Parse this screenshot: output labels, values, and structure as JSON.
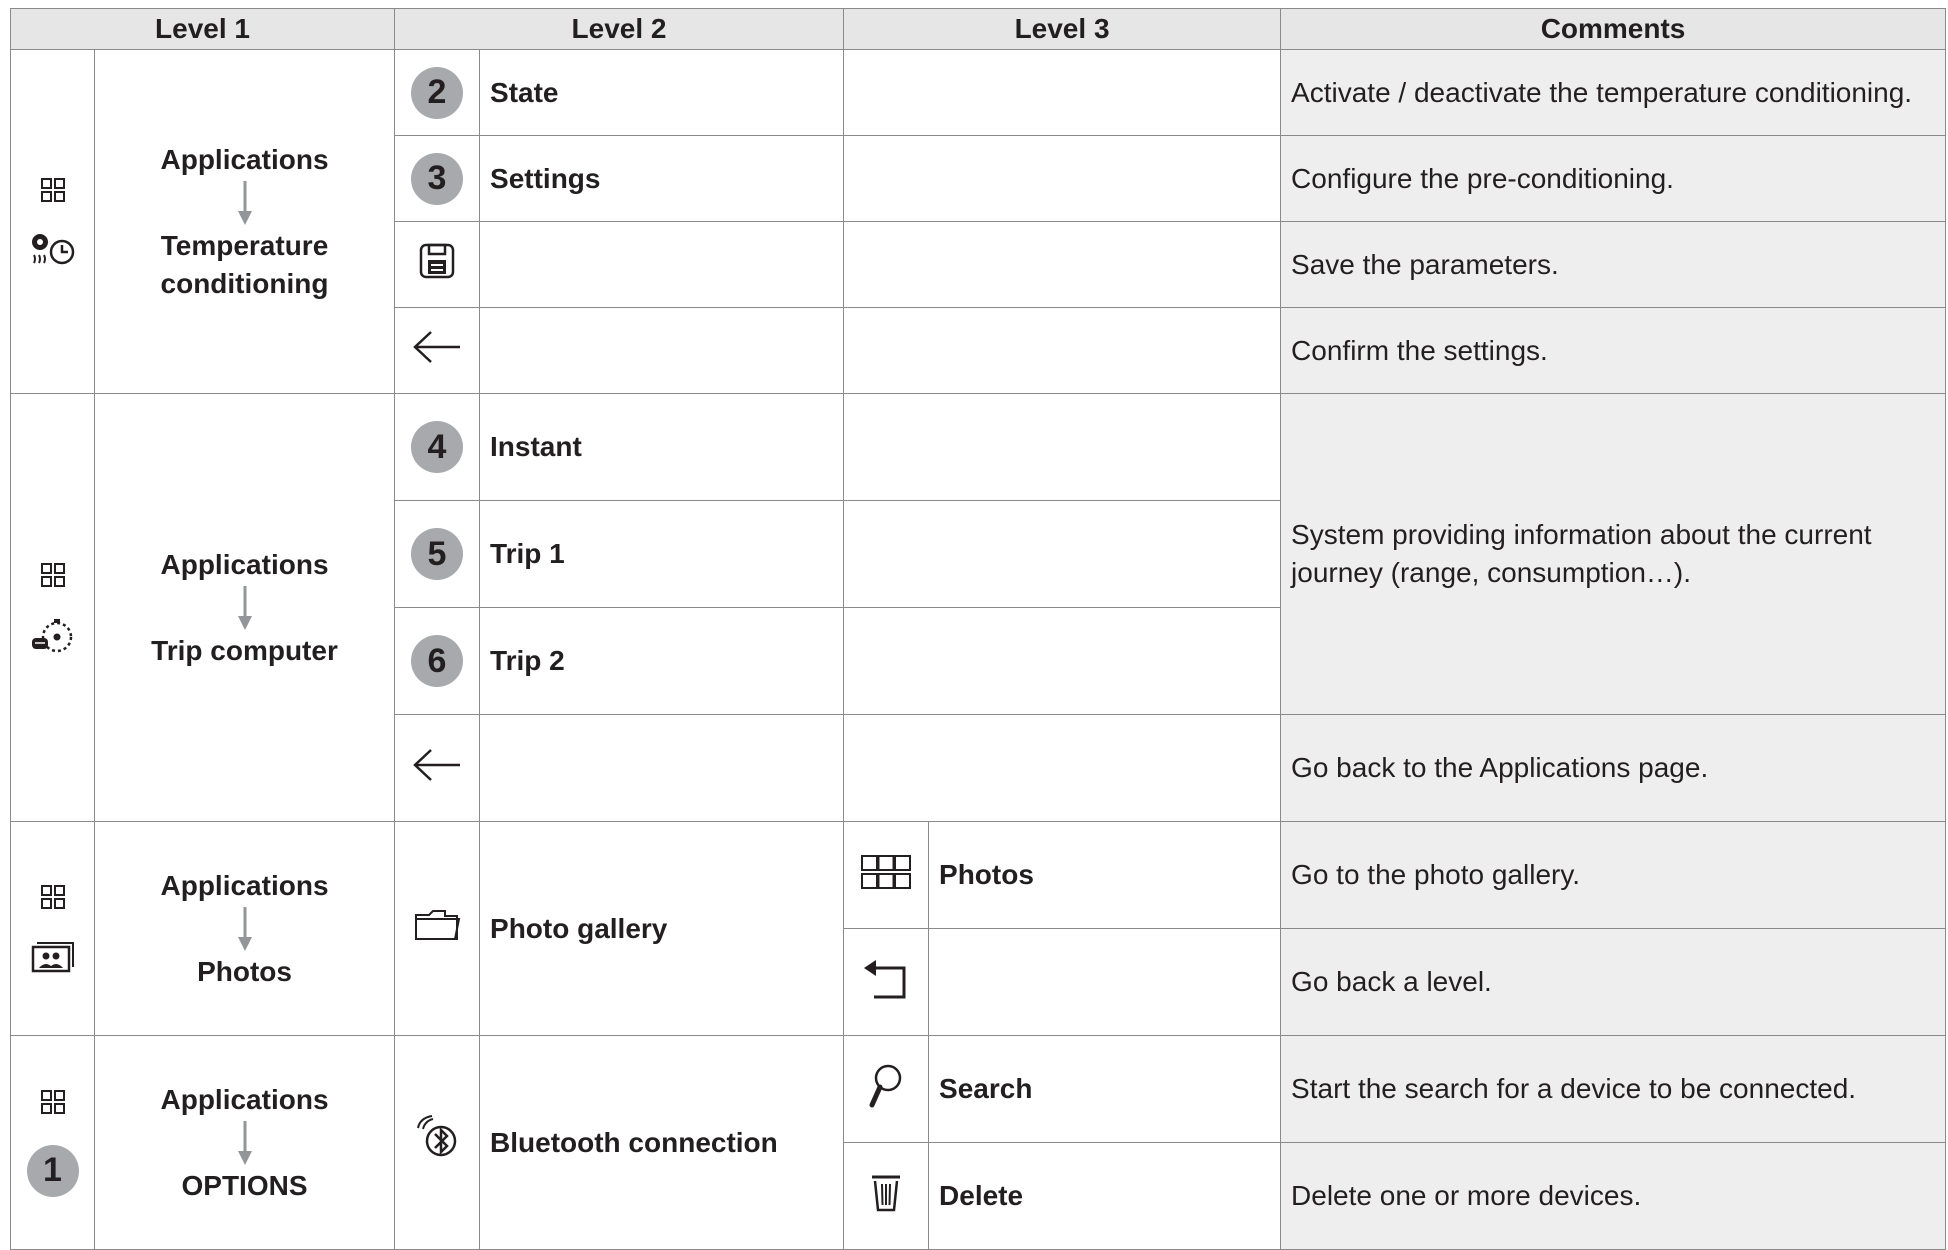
{
  "headers": [
    "Level 1",
    "Level 2",
    "Level 3",
    "Comments"
  ],
  "sections": [
    {
      "l1_top": "Applications",
      "l1_bottom": "Temperature conditioning",
      "section_icon": "fan-clock-icon",
      "rows": [
        {
          "badge": "2",
          "label": "State",
          "comment": "Activate / deactivate the temperature conditioning."
        },
        {
          "badge": "3",
          "label": "Settings",
          "comment": "Configure the pre-conditioning."
        },
        {
          "icon": "save-icon",
          "comment": "Save the parameters."
        },
        {
          "icon": "back-arrow-icon",
          "comment": "Confirm the settings."
        }
      ]
    },
    {
      "l1_top": "Applications",
      "l1_bottom": "Trip computer",
      "section_icon": "trip-computer-icon",
      "rows": [
        {
          "badge": "4",
          "label": "Instant"
        },
        {
          "badge": "5",
          "label": "Trip 1"
        },
        {
          "badge": "6",
          "label": "Trip 2"
        },
        {
          "icon": "back-arrow-icon",
          "comment": "Go back to the Applications page."
        }
      ],
      "merged_comment": "System providing information about the current journey (range, consumption…)."
    },
    {
      "l1_top": "Applications",
      "l1_bottom": "Photos",
      "section_icon": "photos-icon",
      "l2_icon": "folder-icon",
      "l2_label": "Photo gallery",
      "rows": [
        {
          "icon": "grid-icon",
          "label": "Photos",
          "comment": "Go to the photo gallery."
        },
        {
          "icon": "return-icon",
          "comment": "Go back a level."
        }
      ]
    },
    {
      "l1_top": "Applications",
      "l1_bottom": "OPTIONS",
      "section_badge": "1",
      "l2_icon": "bluetooth-icon",
      "l2_label": "Bluetooth connection",
      "rows": [
        {
          "icon": "search-icon",
          "label": "Search",
          "comment": "Start the search for a device to be connected."
        },
        {
          "icon": "trash-icon",
          "label": "Delete",
          "comment": "Delete one or more devices."
        }
      ]
    }
  ]
}
